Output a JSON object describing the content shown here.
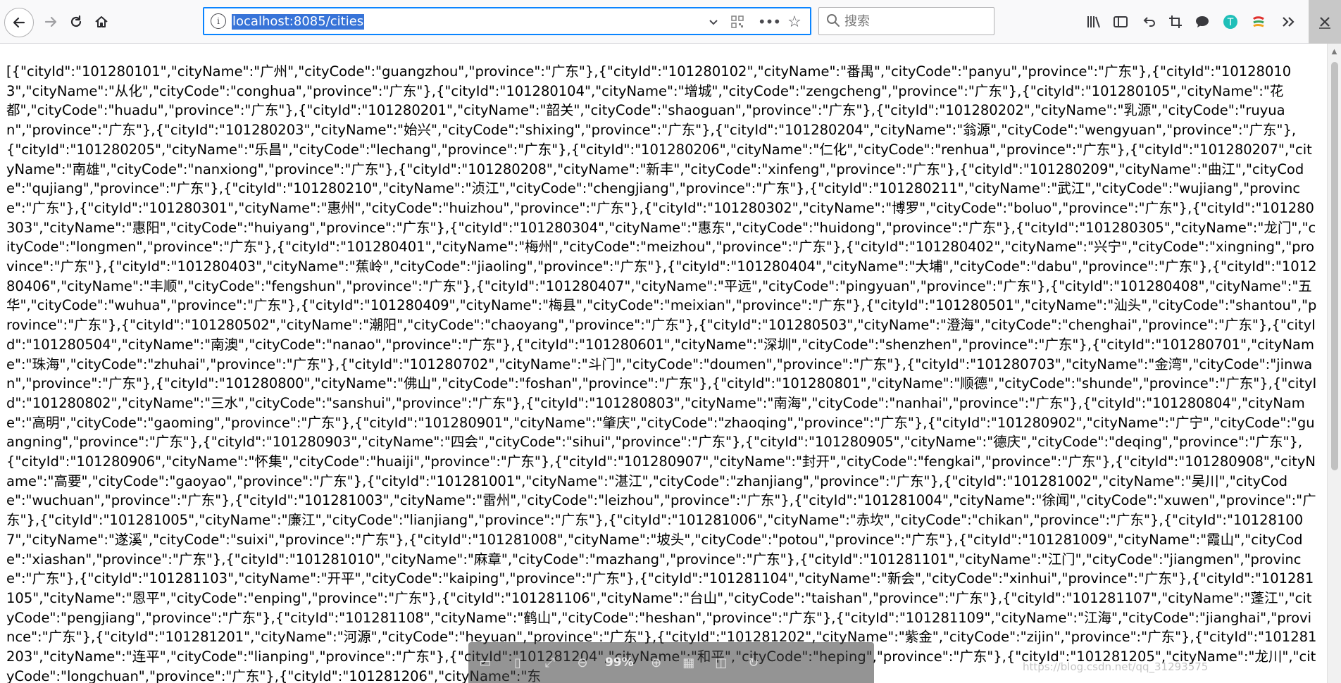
{
  "toolbar": {
    "url": "localhost:8085/cities",
    "search_placeholder": "搜索",
    "icons": {
      "back": "back-arrow-icon",
      "forward": "forward-arrow-icon",
      "reload": "reload-icon",
      "home": "home-icon",
      "site_info": "info-icon",
      "dropdown": "chevron-down-icon",
      "qr": "qr-code-icon",
      "more": "more-dots-icon",
      "bookmark": "star-icon",
      "library": "library-icon",
      "sidebar": "sidebar-icon",
      "undo": "undo-icon",
      "crop": "screenshot-icon",
      "chat": "chat-bubble-icon",
      "extension1": "extension-t-icon",
      "extension2": "extension-s-icon",
      "overflow": "overflow-chevrons-icon",
      "close": "close-icon"
    }
  },
  "content": {
    "json_text": "[{\"cityId\":\"101280101\",\"cityName\":\"广州\",\"cityCode\":\"guangzhou\",\"province\":\"广东\"},{\"cityId\":\"101280102\",\"cityName\":\"番禺\",\"cityCode\":\"panyu\",\"province\":\"广东\"},{\"cityId\":\"101280103\",\"cityName\":\"从化\",\"cityCode\":\"conghua\",\"province\":\"广东\"},{\"cityId\":\"101280104\",\"cityName\":\"增城\",\"cityCode\":\"zengcheng\",\"province\":\"广东\"},{\"cityId\":\"101280105\",\"cityName\":\"花都\",\"cityCode\":\"huadu\",\"province\":\"广东\"},{\"cityId\":\"101280201\",\"cityName\":\"韶关\",\"cityCode\":\"shaoguan\",\"province\":\"广东\"},{\"cityId\":\"101280202\",\"cityName\":\"乳源\",\"cityCode\":\"ruyuan\",\"province\":\"广东\"},{\"cityId\":\"101280203\",\"cityName\":\"始兴\",\"cityCode\":\"shixing\",\"province\":\"广东\"},{\"cityId\":\"101280204\",\"cityName\":\"翁源\",\"cityCode\":\"wengyuan\",\"province\":\"广东\"},{\"cityId\":\"101280205\",\"cityName\":\"乐昌\",\"cityCode\":\"lechang\",\"province\":\"广东\"},{\"cityId\":\"101280206\",\"cityName\":\"仁化\",\"cityCode\":\"renhua\",\"province\":\"广东\"},{\"cityId\":\"101280207\",\"cityName\":\"南雄\",\"cityCode\":\"nanxiong\",\"province\":\"广东\"},{\"cityId\":\"101280208\",\"cityName\":\"新丰\",\"cityCode\":\"xinfeng\",\"province\":\"广东\"},{\"cityId\":\"101280209\",\"cityName\":\"曲江\",\"cityCode\":\"qujiang\",\"province\":\"广东\"},{\"cityId\":\"101280210\",\"cityName\":\"浈江\",\"cityCode\":\"chengjiang\",\"province\":\"广东\"},{\"cityId\":\"101280211\",\"cityName\":\"武江\",\"cityCode\":\"wujiang\",\"province\":\"广东\"},{\"cityId\":\"101280301\",\"cityName\":\"惠州\",\"cityCode\":\"huizhou\",\"province\":\"广东\"},{\"cityId\":\"101280302\",\"cityName\":\"博罗\",\"cityCode\":\"boluo\",\"province\":\"广东\"},{\"cityId\":\"101280303\",\"cityName\":\"惠阳\",\"cityCode\":\"huiyang\",\"province\":\"广东\"},{\"cityId\":\"101280304\",\"cityName\":\"惠东\",\"cityCode\":\"huidong\",\"province\":\"广东\"},{\"cityId\":\"101280305\",\"cityName\":\"龙门\",\"cityCode\":\"longmen\",\"province\":\"广东\"},{\"cityId\":\"101280401\",\"cityName\":\"梅州\",\"cityCode\":\"meizhou\",\"province\":\"广东\"},{\"cityId\":\"101280402\",\"cityName\":\"兴宁\",\"cityCode\":\"xingning\",\"province\":\"广东\"},{\"cityId\":\"101280403\",\"cityName\":\"蕉岭\",\"cityCode\":\"jiaoling\",\"province\":\"广东\"},{\"cityId\":\"101280404\",\"cityName\":\"大埔\",\"cityCode\":\"dabu\",\"province\":\"广东\"},{\"cityId\":\"101280406\",\"cityName\":\"丰顺\",\"cityCode\":\"fengshun\",\"province\":\"广东\"},{\"cityId\":\"101280407\",\"cityName\":\"平远\",\"cityCode\":\"pingyuan\",\"province\":\"广东\"},{\"cityId\":\"101280408\",\"cityName\":\"五华\",\"cityCode\":\"wuhua\",\"province\":\"广东\"},{\"cityId\":\"101280409\",\"cityName\":\"梅县\",\"cityCode\":\"meixian\",\"province\":\"广东\"},{\"cityId\":\"101280501\",\"cityName\":\"汕头\",\"cityCode\":\"shantou\",\"province\":\"广东\"},{\"cityId\":\"101280502\",\"cityName\":\"潮阳\",\"cityCode\":\"chaoyang\",\"province\":\"广东\"},{\"cityId\":\"101280503\",\"cityName\":\"澄海\",\"cityCode\":\"chenghai\",\"province\":\"广东\"},{\"cityId\":\"101280504\",\"cityName\":\"南澳\",\"cityCode\":\"nanao\",\"province\":\"广东\"},{\"cityId\":\"101280601\",\"cityName\":\"深圳\",\"cityCode\":\"shenzhen\",\"province\":\"广东\"},{\"cityId\":\"101280701\",\"cityName\":\"珠海\",\"cityCode\":\"zhuhai\",\"province\":\"广东\"},{\"cityId\":\"101280702\",\"cityName\":\"斗门\",\"cityCode\":\"doumen\",\"province\":\"广东\"},{\"cityId\":\"101280703\",\"cityName\":\"金湾\",\"cityCode\":\"jinwan\",\"province\":\"广东\"},{\"cityId\":\"101280800\",\"cityName\":\"佛山\",\"cityCode\":\"foshan\",\"province\":\"广东\"},{\"cityId\":\"101280801\",\"cityName\":\"顺德\",\"cityCode\":\"shunde\",\"province\":\"广东\"},{\"cityId\":\"101280802\",\"cityName\":\"三水\",\"cityCode\":\"sanshui\",\"province\":\"广东\"},{\"cityId\":\"101280803\",\"cityName\":\"南海\",\"cityCode\":\"nanhai\",\"province\":\"广东\"},{\"cityId\":\"101280804\",\"cityName\":\"高明\",\"cityCode\":\"gaoming\",\"province\":\"广东\"},{\"cityId\":\"101280901\",\"cityName\":\"肇庆\",\"cityCode\":\"zhaoqing\",\"province\":\"广东\"},{\"cityId\":\"101280902\",\"cityName\":\"广宁\",\"cityCode\":\"guangning\",\"province\":\"广东\"},{\"cityId\":\"101280903\",\"cityName\":\"四会\",\"cityCode\":\"sihui\",\"province\":\"广东\"},{\"cityId\":\"101280905\",\"cityName\":\"德庆\",\"cityCode\":\"deqing\",\"province\":\"广东\"},{\"cityId\":\"101280906\",\"cityName\":\"怀集\",\"cityCode\":\"huaiji\",\"province\":\"广东\"},{\"cityId\":\"101280907\",\"cityName\":\"封开\",\"cityCode\":\"fengkai\",\"province\":\"广东\"},{\"cityId\":\"101280908\",\"cityName\":\"高要\",\"cityCode\":\"gaoyao\",\"province\":\"广东\"},{\"cityId\":\"101281001\",\"cityName\":\"湛江\",\"cityCode\":\"zhanjiang\",\"province\":\"广东\"},{\"cityId\":\"101281002\",\"cityName\":\"吴川\",\"cityCode\":\"wuchuan\",\"province\":\"广东\"},{\"cityId\":\"101281003\",\"cityName\":\"雷州\",\"cityCode\":\"leizhou\",\"province\":\"广东\"},{\"cityId\":\"101281004\",\"cityName\":\"徐闻\",\"cityCode\":\"xuwen\",\"province\":\"广东\"},{\"cityId\":\"101281005\",\"cityName\":\"廉江\",\"cityCode\":\"lianjiang\",\"province\":\"广东\"},{\"cityId\":\"101281006\",\"cityName\":\"赤坎\",\"cityCode\":\"chikan\",\"province\":\"广东\"},{\"cityId\":\"101281007\",\"cityName\":\"遂溪\",\"cityCode\":\"suixi\",\"province\":\"广东\"},{\"cityId\":\"101281008\",\"cityName\":\"坡头\",\"cityCode\":\"potou\",\"province\":\"广东\"},{\"cityId\":\"101281009\",\"cityName\":\"霞山\",\"cityCode\":\"xiashan\",\"province\":\"广东\"},{\"cityId\":\"101281010\",\"cityName\":\"麻章\",\"cityCode\":\"mazhang\",\"province\":\"广东\"},{\"cityId\":\"101281101\",\"cityName\":\"江门\",\"cityCode\":\"jiangmen\",\"province\":\"广东\"},{\"cityId\":\"101281103\",\"cityName\":\"开平\",\"cityCode\":\"kaiping\",\"province\":\"广东\"},{\"cityId\":\"101281104\",\"cityName\":\"新会\",\"cityCode\":\"xinhui\",\"province\":\"广东\"},{\"cityId\":\"101281105\",\"cityName\":\"恩平\",\"cityCode\":\"enping\",\"province\":\"广东\"},{\"cityId\":\"101281106\",\"cityName\":\"台山\",\"cityCode\":\"taishan\",\"province\":\"广东\"},{\"cityId\":\"101281107\",\"cityName\":\"蓬江\",\"cityCode\":\"pengjiang\",\"province\":\"广东\"},{\"cityId\":\"101281108\",\"cityName\":\"鹤山\",\"cityCode\":\"heshan\",\"province\":\"广东\"},{\"cityId\":\"101281109\",\"cityName\":\"江海\",\"cityCode\":\"jianghai\",\"province\":\"广东\"},{\"cityId\":\"101281201\",\"cityName\":\"河源\",\"cityCode\":\"heyuan\",\"province\":\"广东\"},{\"cityId\":\"101281202\",\"cityName\":\"紫金\",\"cityCode\":\"zijin\",\"province\":\"广东\"},{\"cityId\":\"101281203\",\"cityName\":\"连平\",\"cityCode\":\"lianping\",\"province\":\"广东\"},{\"cityId\":\"101281204\",\"cityName\":\"和平\",\"cityCode\":\"heping\",\"province\":\"广东\"},{\"cityId\":\"101281205\",\"cityName\":\"龙川\",\"cityCode\":\"longchuan\",\"province\":\"广东\"},{\"cityId\":\"101281206\",\"cityName\":\"东"
  },
  "overlay": {
    "zoom": "99%",
    "watermark": "https://blog.csdn.net/qq_31293575"
  }
}
